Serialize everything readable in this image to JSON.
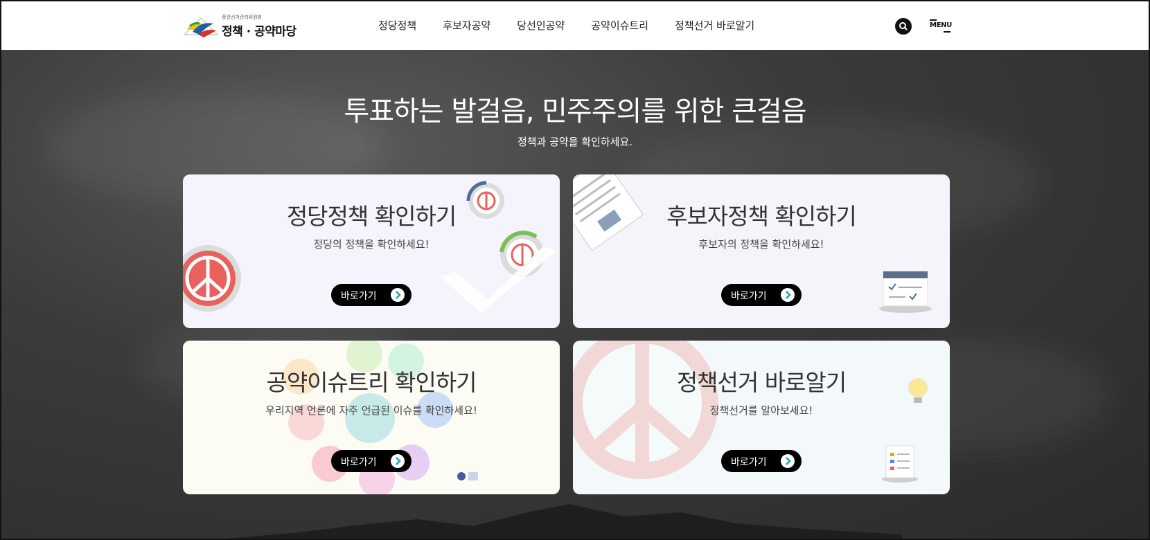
{
  "header": {
    "logo_small": "중앙선거관리위원회",
    "logo_main": "정책 · 공약마당",
    "nav": [
      "정당정책",
      "후보자공약",
      "당선인공약",
      "공약이슈트리",
      "정책선거 바로알기"
    ],
    "menu_label": "MENU"
  },
  "hero": {
    "title": "투표하는 발걸음, 민주주의를 위한 큰걸음",
    "subtitle": "정책과 공약을 확인하세요."
  },
  "cards": [
    {
      "title": "정당정책 확인하기",
      "desc": "정당의 정책을 확인하세요!",
      "button": "바로가기"
    },
    {
      "title": "후보자정책 확인하기",
      "desc": "후보자의 정책을 확인하세요!",
      "button": "바로가기"
    },
    {
      "title": "공약이슈트리 확인하기",
      "desc": "우리지역 언론에 자주 언급된 이슈를 확인하세요!",
      "button": "바로가기"
    },
    {
      "title": "정책선거 바로알기",
      "desc": "정책선거를 알아보세요!",
      "button": "바로가기"
    }
  ],
  "icons": {
    "search": "search-icon",
    "arrow": "arrow-right-icon",
    "vote_stamp": "vote-stamp-icon"
  },
  "colors": {
    "accent_red": "#e8615c",
    "accent_teal": "#1aa3a3",
    "header_bg": "#ffffff",
    "button_bg": "#000000"
  }
}
